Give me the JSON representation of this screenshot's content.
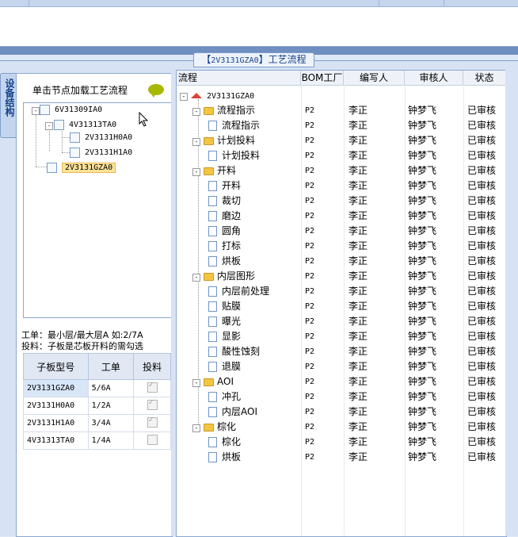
{
  "title": {
    "prefix": "【",
    "code": "2V3131GZA0",
    "suffix": "】工艺流程"
  },
  "vertical_tab": "设备结构",
  "left": {
    "header": "单击节点加载工艺流程",
    "tree": [
      {
        "label": "6V31309IA0",
        "level": 0
      },
      {
        "label": "4V31313TA0",
        "level": 1
      },
      {
        "label": "2V3131H0A0",
        "level": 2
      },
      {
        "label": "2V3131H1A0",
        "level": 2
      },
      {
        "label": "2V3131GZA0",
        "level": 1,
        "selected": true
      }
    ],
    "hint_line1": "工单：最小层/最大层A 如:2/7A",
    "hint_line2": "投料：子板是芯板开料的需勾选",
    "table_headers": {
      "model": "子板型号",
      "order": "工单",
      "feed": "投料"
    },
    "table_rows": [
      {
        "model": "2V3131GZA0",
        "order": "5/6A",
        "feed": true
      },
      {
        "model": "2V3131H0A0",
        "order": "1/2A",
        "feed": true
      },
      {
        "model": "2V3131H1A0",
        "order": "3/4A",
        "feed": true
      },
      {
        "model": "4V31313TA0",
        "order": "1/4A",
        "feed": false
      }
    ]
  },
  "grid": {
    "headers": {
      "flow": "流程",
      "factory": "BOM工厂",
      "writer": "编写人",
      "reviewer": "审核人",
      "status": "状态"
    },
    "root": "2V3131GZA0",
    "rows": [
      {
        "name": "流程指示",
        "type": "folder",
        "factory": "P2",
        "writer": "李正",
        "reviewer": "钟梦飞",
        "status": "已审核"
      },
      {
        "name": "流程指示",
        "type": "doc",
        "factory": "P2",
        "writer": "李正",
        "reviewer": "钟梦飞",
        "status": "已审核"
      },
      {
        "name": "计划投料",
        "type": "folder",
        "factory": "P2",
        "writer": "李正",
        "reviewer": "钟梦飞",
        "status": "已审核"
      },
      {
        "name": "计划投料",
        "type": "doc",
        "factory": "P2",
        "writer": "李正",
        "reviewer": "钟梦飞",
        "status": "已审核"
      },
      {
        "name": "开料",
        "type": "folder",
        "factory": "P2",
        "writer": "李正",
        "reviewer": "钟梦飞",
        "status": "已审核"
      },
      {
        "name": "开料",
        "type": "doc",
        "factory": "P2",
        "writer": "李正",
        "reviewer": "钟梦飞",
        "status": "已审核"
      },
      {
        "name": "裁切",
        "type": "doc",
        "factory": "P2",
        "writer": "李正",
        "reviewer": "钟梦飞",
        "status": "已审核"
      },
      {
        "name": "磨边",
        "type": "doc",
        "factory": "P2",
        "writer": "李正",
        "reviewer": "钟梦飞",
        "status": "已审核"
      },
      {
        "name": "圆角",
        "type": "doc",
        "factory": "P2",
        "writer": "李正",
        "reviewer": "钟梦飞",
        "status": "已审核"
      },
      {
        "name": "打标",
        "type": "doc",
        "factory": "P2",
        "writer": "李正",
        "reviewer": "钟梦飞",
        "status": "已审核"
      },
      {
        "name": "烘板",
        "type": "doc",
        "factory": "P2",
        "writer": "李正",
        "reviewer": "钟梦飞",
        "status": "已审核"
      },
      {
        "name": "内层图形",
        "type": "folder",
        "factory": "P2",
        "writer": "李正",
        "reviewer": "钟梦飞",
        "status": "已审核"
      },
      {
        "name": "内层前处理",
        "type": "doc",
        "factory": "P2",
        "writer": "李正",
        "reviewer": "钟梦飞",
        "status": "已审核"
      },
      {
        "name": "贴膜",
        "type": "doc",
        "factory": "P2",
        "writer": "李正",
        "reviewer": "钟梦飞",
        "status": "已审核"
      },
      {
        "name": "曝光",
        "type": "doc",
        "factory": "P2",
        "writer": "李正",
        "reviewer": "钟梦飞",
        "status": "已审核"
      },
      {
        "name": "显影",
        "type": "doc",
        "factory": "P2",
        "writer": "李正",
        "reviewer": "钟梦飞",
        "status": "已审核"
      },
      {
        "name": "酸性蚀刻",
        "type": "doc",
        "factory": "P2",
        "writer": "李正",
        "reviewer": "钟梦飞",
        "status": "已审核"
      },
      {
        "name": "退膜",
        "type": "doc",
        "factory": "P2",
        "writer": "李正",
        "reviewer": "钟梦飞",
        "status": "已审核"
      },
      {
        "name": "AOI",
        "type": "folder",
        "factory": "P2",
        "writer": "李正",
        "reviewer": "钟梦飞",
        "status": "已审核"
      },
      {
        "name": "冲孔",
        "type": "doc",
        "factory": "P2",
        "writer": "李正",
        "reviewer": "钟梦飞",
        "status": "已审核"
      },
      {
        "name": "内层AOI",
        "type": "doc",
        "factory": "P2",
        "writer": "李正",
        "reviewer": "钟梦飞",
        "status": "已审核"
      },
      {
        "name": "棕化",
        "type": "folder",
        "factory": "P2",
        "writer": "李正",
        "reviewer": "钟梦飞",
        "status": "已审核"
      },
      {
        "name": "棕化",
        "type": "doc",
        "factory": "P2",
        "writer": "李正",
        "reviewer": "钟梦飞",
        "status": "已审核"
      },
      {
        "name": "烘板",
        "type": "doc",
        "factory": "P2",
        "writer": "李正",
        "reviewer": "钟梦飞",
        "status": "已审核"
      }
    ]
  }
}
